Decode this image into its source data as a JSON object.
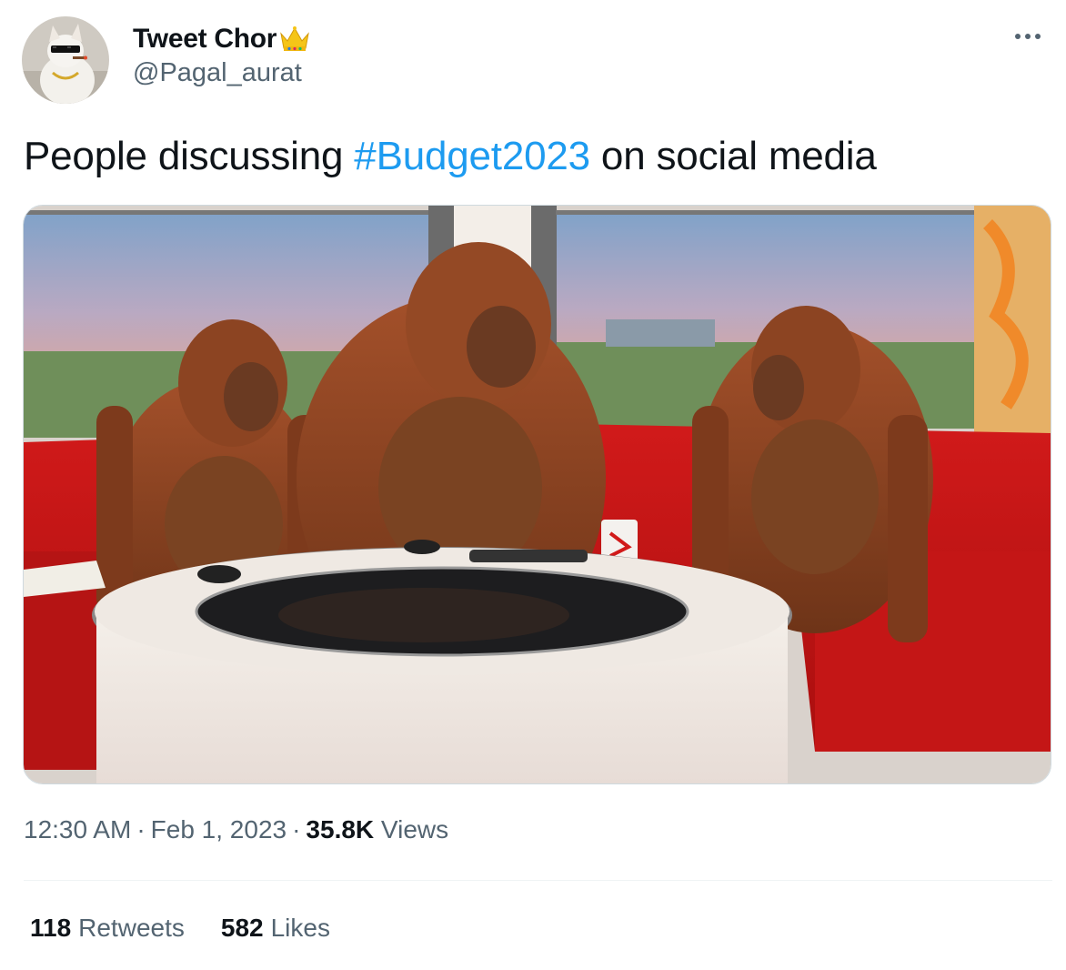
{
  "user": {
    "display_name": "Tweet Chor",
    "handle": "@Pagal_aurat",
    "badge_icon": "crown-icon",
    "avatar_icon": "cat-with-sunglasses-avatar"
  },
  "tweet": {
    "text_before": "People discussing ",
    "hashtag": "#Budget2023",
    "text_after": " on social media",
    "media_description_icon": "orangutans-news-desk-image"
  },
  "meta": {
    "time": "12:30 AM",
    "separator": "·",
    "date": "Feb 1, 2023",
    "views_count": "35.8K",
    "views_label": "Views"
  },
  "stats": {
    "retweets_count": "118",
    "retweets_label": "Retweets",
    "likes_count": "582",
    "likes_label": "Likes"
  },
  "colors": {
    "link": "#1d9bf0",
    "secondary_text": "#536471",
    "primary_text": "#0f1419",
    "divider": "#eff3f4"
  }
}
